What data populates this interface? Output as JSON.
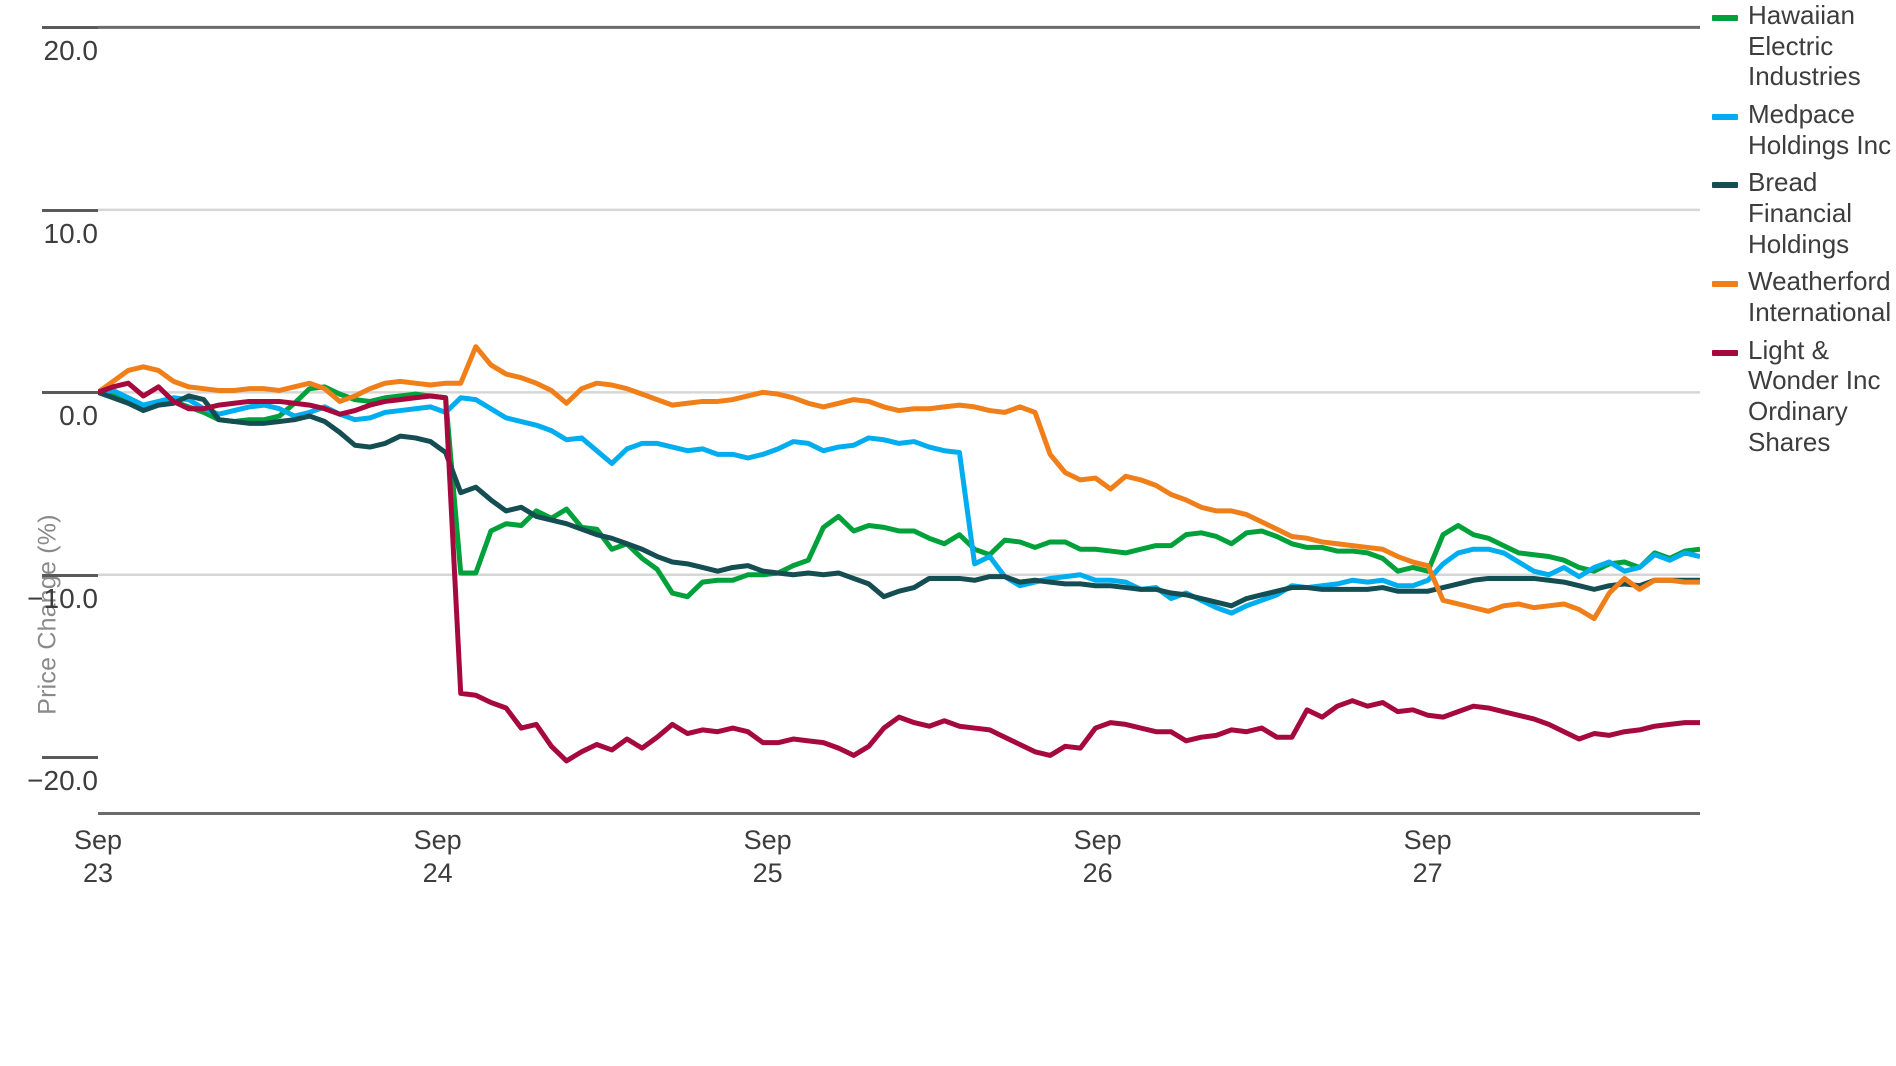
{
  "chart_data": {
    "type": "line",
    "title": "",
    "subtitle": "",
    "xlabel": "",
    "ylabel": "Price Change (%)",
    "ylim": [
      -23.0,
      21.5
    ],
    "xlim": [
      0,
      100
    ],
    "grid": true,
    "gridlines_y": [
      20.0,
      10.0,
      0.0,
      -10.0
    ],
    "legend_position": "right",
    "ytick_labels": [
      "20.0",
      "10.0",
      "0.0",
      "−10.0",
      "−20.0"
    ],
    "ytick_values": [
      20.0,
      10.0,
      0.0,
      -10.0,
      -20.0
    ],
    "xtick_labels": [
      {
        "line1": "Sep",
        "line2": "23"
      },
      {
        "line1": "Sep",
        "line2": "24"
      },
      {
        "line1": "Sep",
        "line2": "25"
      },
      {
        "line1": "Sep",
        "line2": "26"
      },
      {
        "line1": "Sep",
        "line2": "27"
      }
    ],
    "xtick_positions": [
      0.0,
      21.2,
      41.8,
      62.4,
      83.0
    ],
    "colors": {
      "hawaiian_electric": "#00A13A",
      "medpace": "#00AEEF",
      "bread_financial": "#144D52",
      "weatherford": "#F07F1A",
      "light_wonder": "#A5093E",
      "gridline": "#d6d6d6",
      "axis": "#6b6b6b",
      "tick_text": "#3d3d3d",
      "axis_label": "#8a8a8a"
    },
    "series": [
      {
        "name": "Hawaiian Electric Industries",
        "color": "#00A13A",
        "values": [
          0.0,
          -0.2,
          -0.5,
          -0.9,
          -0.6,
          -0.5,
          -0.8,
          -1.1,
          -1.5,
          -1.6,
          -1.5,
          -1.5,
          -1.3,
          -0.6,
          0.2,
          0.3,
          -0.1,
          -0.4,
          -0.5,
          -0.3,
          -0.2,
          -0.1,
          -0.2,
          -0.3,
          -9.9,
          -9.9,
          -7.6,
          -7.2,
          -7.3,
          -6.5,
          -6.9,
          -6.4,
          -7.4,
          -7.5,
          -8.6,
          -8.3,
          -9.1,
          -9.7,
          -11.0,
          -11.2,
          -10.4,
          -10.3,
          -10.3,
          -10.0,
          -10.0,
          -9.9,
          -9.5,
          -9.2,
          -7.4,
          -6.8,
          -7.6,
          -7.3,
          -7.4,
          -7.6,
          -7.6,
          -8.0,
          -8.3,
          -7.8,
          -8.6,
          -8.9,
          -8.1,
          -8.2,
          -8.5,
          -8.2,
          -8.2,
          -8.6,
          -8.6,
          -8.7,
          -8.8,
          -8.6,
          -8.4,
          -8.4,
          -7.8,
          -7.7,
          -7.9,
          -8.3,
          -7.7,
          -7.6,
          -7.9,
          -8.3,
          -8.5,
          -8.5,
          -8.7,
          -8.7,
          -8.8,
          -9.1,
          -9.8,
          -9.6,
          -9.8,
          -7.8,
          -7.3,
          -7.8,
          -8.0,
          -8.4,
          -8.8,
          -8.9,
          -9.0,
          -9.2,
          -9.6,
          -9.8,
          -9.4,
          -9.3,
          -9.6,
          -8.8,
          -9.1,
          -8.7,
          -8.6
        ]
      },
      {
        "name": "Medpace Holdings Inc",
        "color": "#00AEEF",
        "values": [
          0.0,
          0.1,
          -0.3,
          -0.7,
          -0.5,
          -0.3,
          -0.4,
          -0.9,
          -1.2,
          -1.0,
          -0.8,
          -0.7,
          -0.9,
          -1.3,
          -1.1,
          -0.8,
          -1.2,
          -1.5,
          -1.4,
          -1.1,
          -1.0,
          -0.9,
          -0.8,
          -1.1,
          -0.3,
          -0.4,
          -0.9,
          -1.4,
          -1.6,
          -1.8,
          -2.1,
          -2.6,
          -2.5,
          -3.2,
          -3.9,
          -3.1,
          -2.8,
          -2.8,
          -3.0,
          -3.2,
          -3.1,
          -3.4,
          -3.4,
          -3.6,
          -3.4,
          -3.1,
          -2.7,
          -2.8,
          -3.2,
          -3.0,
          -2.9,
          -2.5,
          -2.6,
          -2.8,
          -2.7,
          -3.0,
          -3.2,
          -3.3,
          -9.4,
          -9.0,
          -10.1,
          -10.6,
          -10.4,
          -10.2,
          -10.1,
          -10.0,
          -10.3,
          -10.3,
          -10.4,
          -10.8,
          -10.7,
          -11.3,
          -11.0,
          -11.4,
          -11.8,
          -12.1,
          -11.7,
          -11.4,
          -11.1,
          -10.6,
          -10.7,
          -10.6,
          -10.5,
          -10.3,
          -10.4,
          -10.3,
          -10.6,
          -10.6,
          -10.3,
          -9.4,
          -8.8,
          -8.6,
          -8.6,
          -8.8,
          -9.3,
          -9.8,
          -10.0,
          -9.6,
          -10.1,
          -9.6,
          -9.3,
          -9.8,
          -9.6,
          -8.9,
          -9.2,
          -8.8,
          -9.0
        ]
      },
      {
        "name": "Bread Financial Holdings",
        "color": "#144D52",
        "values": [
          0.0,
          -0.3,
          -0.6,
          -1.0,
          -0.7,
          -0.6,
          -0.2,
          -0.4,
          -1.5,
          -1.6,
          -1.7,
          -1.7,
          -1.6,
          -1.5,
          -1.3,
          -1.6,
          -2.2,
          -2.9,
          -3.0,
          -2.8,
          -2.4,
          -2.5,
          -2.7,
          -3.3,
          -5.5,
          -5.2,
          -5.9,
          -6.5,
          -6.3,
          -6.8,
          -7.0,
          -7.2,
          -7.5,
          -7.8,
          -8.0,
          -8.3,
          -8.6,
          -9.0,
          -9.3,
          -9.4,
          -9.6,
          -9.8,
          -9.6,
          -9.5,
          -9.8,
          -9.9,
          -10.0,
          -9.9,
          -10.0,
          -9.9,
          -10.2,
          -10.5,
          -11.2,
          -10.9,
          -10.7,
          -10.2,
          -10.2,
          -10.2,
          -10.3,
          -10.1,
          -10.1,
          -10.4,
          -10.3,
          -10.4,
          -10.5,
          -10.5,
          -10.6,
          -10.6,
          -10.7,
          -10.8,
          -10.8,
          -11.0,
          -11.1,
          -11.3,
          -11.5,
          -11.7,
          -11.3,
          -11.1,
          -10.9,
          -10.7,
          -10.7,
          -10.8,
          -10.8,
          -10.8,
          -10.8,
          -10.7,
          -10.9,
          -10.9,
          -10.9,
          -10.7,
          -10.5,
          -10.3,
          -10.2,
          -10.2,
          -10.2,
          -10.2,
          -10.3,
          -10.4,
          -10.6,
          -10.8,
          -10.6,
          -10.5,
          -10.6,
          -10.3,
          -10.3,
          -10.3,
          -10.3
        ]
      },
      {
        "name": "Weatherford International",
        "color": "#F07F1A",
        "values": [
          0.0,
          0.6,
          1.2,
          1.4,
          1.2,
          0.6,
          0.3,
          0.2,
          0.1,
          0.1,
          0.2,
          0.2,
          0.1,
          0.3,
          0.5,
          0.2,
          -0.5,
          -0.2,
          0.2,
          0.5,
          0.6,
          0.5,
          0.4,
          0.5,
          0.5,
          2.5,
          1.5,
          1.0,
          0.8,
          0.5,
          0.1,
          -0.6,
          0.2,
          0.5,
          0.4,
          0.2,
          -0.1,
          -0.4,
          -0.7,
          -0.6,
          -0.5,
          -0.5,
          -0.4,
          -0.2,
          0.0,
          -0.1,
          -0.3,
          -0.6,
          -0.8,
          -0.6,
          -0.4,
          -0.5,
          -0.8,
          -1.0,
          -0.9,
          -0.9,
          -0.8,
          -0.7,
          -0.8,
          -1.0,
          -1.1,
          -0.8,
          -1.1,
          -3.4,
          -4.4,
          -4.8,
          -4.7,
          -5.3,
          -4.6,
          -4.8,
          -5.1,
          -5.6,
          -5.9,
          -6.3,
          -6.5,
          -6.5,
          -6.7,
          -7.1,
          -7.5,
          -7.9,
          -8.0,
          -8.2,
          -8.3,
          -8.4,
          -8.5,
          -8.6,
          -9.0,
          -9.3,
          -9.5,
          -11.4,
          -11.6,
          -11.8,
          -12.0,
          -11.7,
          -11.6,
          -11.8,
          -11.7,
          -11.6,
          -11.9,
          -12.4,
          -11.0,
          -10.2,
          -10.8,
          -10.3,
          -10.3,
          -10.4,
          -10.4
        ]
      },
      {
        "name": "Light & Wonder Inc Ordinary Shares",
        "color": "#A5093E",
        "values": [
          0.0,
          0.3,
          0.5,
          -0.2,
          0.3,
          -0.5,
          -0.9,
          -0.9,
          -0.7,
          -0.6,
          -0.5,
          -0.5,
          -0.5,
          -0.6,
          -0.7,
          -0.9,
          -1.2,
          -1.0,
          -0.7,
          -0.5,
          -0.4,
          -0.3,
          -0.2,
          -0.3,
          -16.5,
          -16.6,
          -17.0,
          -17.3,
          -18.4,
          -18.2,
          -19.4,
          -20.2,
          -19.7,
          -19.3,
          -19.6,
          -19.0,
          -19.5,
          -18.9,
          -18.2,
          -18.7,
          -18.5,
          -18.6,
          -18.4,
          -18.6,
          -19.2,
          -19.2,
          -19.0,
          -19.1,
          -19.2,
          -19.5,
          -19.9,
          -19.4,
          -18.4,
          -17.8,
          -18.1,
          -18.3,
          -18.0,
          -18.3,
          -18.4,
          -18.5,
          -18.9,
          -19.3,
          -19.7,
          -19.9,
          -19.4,
          -19.5,
          -18.4,
          -18.1,
          -18.2,
          -18.4,
          -18.6,
          -18.6,
          -19.1,
          -18.9,
          -18.8,
          -18.5,
          -18.6,
          -18.4,
          -18.9,
          -18.9,
          -17.4,
          -17.8,
          -17.2,
          -16.9,
          -17.2,
          -17.0,
          -17.5,
          -17.4,
          -17.7,
          -17.8,
          -17.5,
          -17.2,
          -17.3,
          -17.5,
          -17.7,
          -17.9,
          -18.2,
          -18.6,
          -19.0,
          -18.7,
          -18.8,
          -18.6,
          -18.5,
          -18.3,
          -18.2,
          -18.1,
          -18.1
        ]
      }
    ]
  },
  "legend": {
    "items": [
      {
        "label": "Hawaiian Electric Industries",
        "color": "#00A13A"
      },
      {
        "label": "Medpace Holdings Inc",
        "color": "#00AEEF"
      },
      {
        "label": "Bread Financial Holdings",
        "color": "#144D52"
      },
      {
        "label": "Weatherford International",
        "color": "#F07F1A"
      },
      {
        "label": "Light & Wonder Inc Ordinary Shares",
        "color": "#A5093E"
      }
    ]
  },
  "axes": {
    "y_title": "Price Change (%)"
  }
}
